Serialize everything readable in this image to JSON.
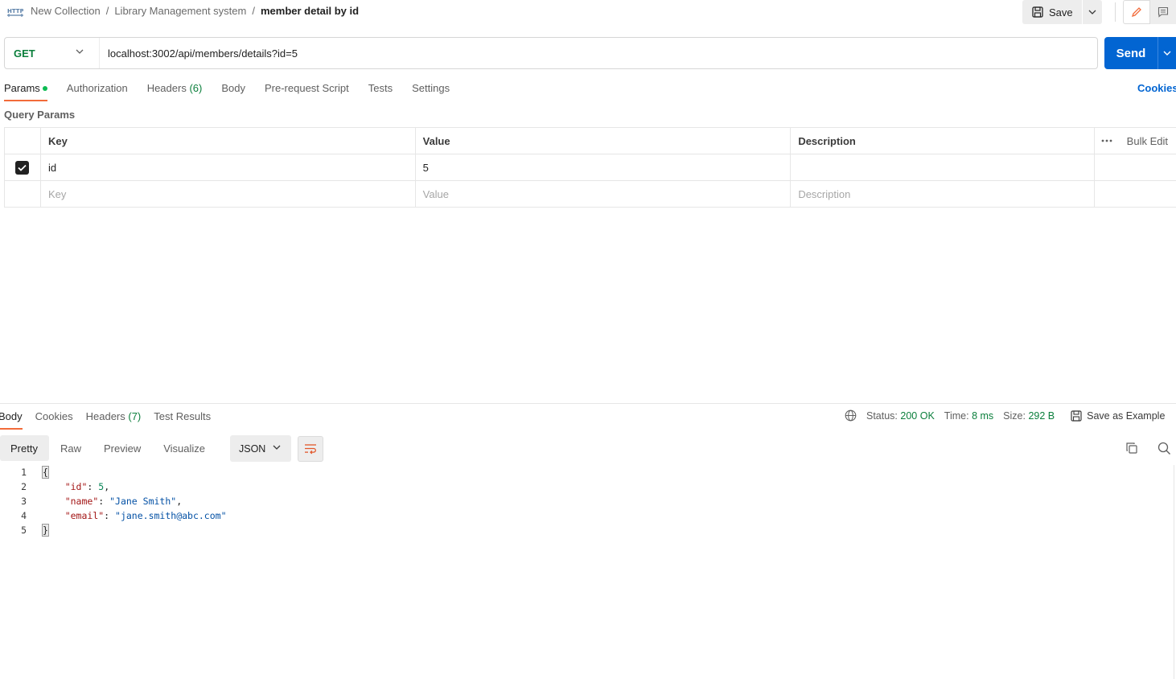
{
  "breadcrumb": {
    "icon": "http-icon",
    "items": [
      "New Collection",
      "Library Management system"
    ],
    "separator": "/",
    "current": "member detail by id"
  },
  "toolbar": {
    "save_label": "Save"
  },
  "request": {
    "method": "GET",
    "url": "localhost:3002/api/members/details?id=5",
    "send_label": "Send"
  },
  "request_tabs": [
    {
      "label": "Params",
      "active": true,
      "dot": true
    },
    {
      "label": "Authorization"
    },
    {
      "label": "Headers",
      "count": "(6)"
    },
    {
      "label": "Body"
    },
    {
      "label": "Pre-request Script"
    },
    {
      "label": "Tests"
    },
    {
      "label": "Settings"
    }
  ],
  "cookies_link": "Cookies",
  "query_params": {
    "title": "Query Params",
    "headers": {
      "key": "Key",
      "value": "Value",
      "description": "Description",
      "bulk_edit": "Bulk Edit"
    },
    "rows": [
      {
        "checked": true,
        "key": "id",
        "value": "5",
        "description": ""
      }
    ],
    "placeholder": {
      "key": "Key",
      "value": "Value",
      "description": "Description"
    }
  },
  "response": {
    "tabs": [
      {
        "label": "Body",
        "active": true
      },
      {
        "label": "Cookies"
      },
      {
        "label": "Headers",
        "count": "(7)"
      },
      {
        "label": "Test Results"
      }
    ],
    "status_label": "Status:",
    "status_value": "200 OK",
    "time_label": "Time:",
    "time_value": "8 ms",
    "size_label": "Size:",
    "size_value": "292 B",
    "save_example": "Save as Example",
    "view_tabs": [
      "Pretty",
      "Raw",
      "Preview",
      "Visualize"
    ],
    "format": "JSON",
    "lines": [
      "1",
      "2",
      "3",
      "4",
      "5"
    ],
    "body": {
      "open": "{",
      "id_key": "\"id\"",
      "id_val": "5",
      "name_key": "\"name\"",
      "name_val": "\"Jane Smith\"",
      "email_key": "\"email\"",
      "email_val": "\"jane.smith@abc.com\"",
      "close": "}"
    }
  },
  "colors": {
    "accent": "#f26b3a",
    "send": "#0265d2",
    "success": "#0b7f3c"
  }
}
